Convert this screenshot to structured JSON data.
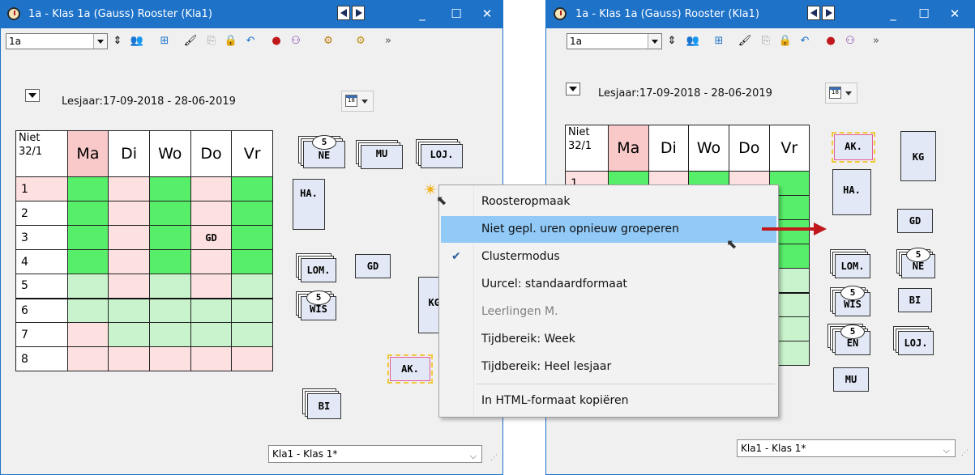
{
  "left": {
    "title": "1a - Klas 1a (Gauss)  Rooster  (Kla1)",
    "combo_value": "1a",
    "date_range": "Lesjaar:17-09-2018 - 28-06-2019",
    "cal_day": "18",
    "corner_label_1": "Niet",
    "corner_label_2": "32/1",
    "days": [
      "Ma",
      "Di",
      "Wo",
      "Do",
      "Vr"
    ],
    "rows": [
      "1",
      "2",
      "3",
      "4",
      "5",
      "6",
      "7",
      "8"
    ],
    "grid_cell_gd": "GD",
    "cards": {
      "ne": "NE",
      "ne_badge": "5",
      "mu": "MU",
      "loj": "LOJ.",
      "ha": "HA.",
      "lom": "LOM.",
      "gd": "GD",
      "wis": "WIS",
      "wis_badge": "5",
      "kg": "KG",
      "ak": "AK.",
      "bi": "BI"
    },
    "status_value": "Kla1 - Klas 1*"
  },
  "right": {
    "title": "1a - Klas 1a (Gauss)  Rooster  (Kla1)",
    "combo_value": "1a",
    "date_range": "Lesjaar:17-09-2018 - 28-06-2019",
    "cal_day": "18",
    "corner_label_1": "Niet",
    "corner_label_2": "32/1",
    "days": [
      "Ma",
      "Di",
      "Wo",
      "Do",
      "Vr"
    ],
    "first_row": "1",
    "cards": {
      "ak": "AK.",
      "kg": "KG",
      "ha": "HA.",
      "gd": "GD",
      "lom": "LOM.",
      "ne": "NE",
      "ne_badge": "5",
      "wis": "WIS",
      "wis_badge": "5",
      "bi": "BI",
      "en": "EN",
      "en_badge": "5",
      "loj": "LOJ.",
      "mu": "MU"
    },
    "status_value": "Kla1 - Klas 1*"
  },
  "context_menu": {
    "items": [
      {
        "label": "Roosteropmaak"
      },
      {
        "label": "Niet gepl. uren opnieuw groeperen"
      },
      {
        "label": "Clustermodus"
      },
      {
        "label": "Uurcel: standaardformaat"
      },
      {
        "label": "Leerlingen M."
      },
      {
        "label": "Tijdbereik: Week"
      },
      {
        "label": "Tijdbereik: Heel lesjaar"
      },
      {
        "label": "In HTML-formaat kopiëren"
      }
    ]
  },
  "colors": {
    "titlebar": "#1e73c9",
    "green": "#57ef6a",
    "light_green": "#c8f3cc",
    "pink": "#fde0e0",
    "highlight": "#91c9f7",
    "arrow": "#c0181b"
  }
}
